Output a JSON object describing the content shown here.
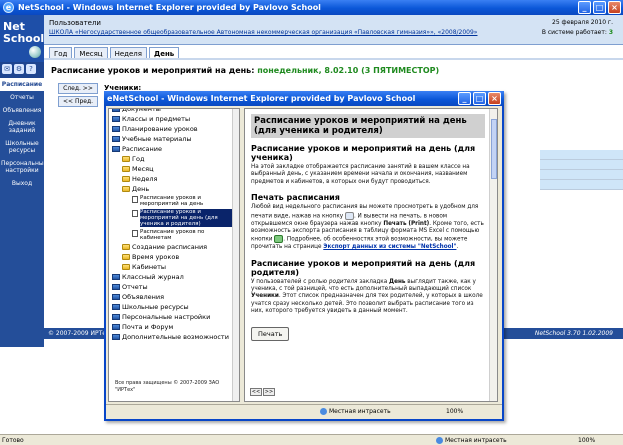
{
  "outer_window": {
    "title": "NetSchool - Windows Internet Explorer provided by Pavlovo School"
  },
  "logo": {
    "line1": "Net",
    "line2": "School"
  },
  "header": {
    "users_label": "Пользователи",
    "school_name": "ШКОЛА «Негосударственное общеобразовательное Автономная некоммерческая организация «Павловская гимназия»», «2008/2009»",
    "date": "25 февраля 2010 г.",
    "online_label": "В системе работает:",
    "online_count": "3"
  },
  "tabs": [
    {
      "label": "Год"
    },
    {
      "label": "Месяц"
    },
    {
      "label": "Неделя"
    },
    {
      "label": "День"
    }
  ],
  "sidebar": {
    "items": [
      {
        "label": "Расписание"
      },
      {
        "label": "Отчеты"
      },
      {
        "label": "Объявления"
      },
      {
        "label": "Дневник заданий"
      },
      {
        "label": "Школьные ресурсы"
      },
      {
        "label": "Персональные настройки"
      },
      {
        "label": "Выход"
      }
    ]
  },
  "page": {
    "heading_main": "Расписание уроков и мероприятий на день:",
    "heading_detail": "понедельник, 8.02.10 (3 ПЯТИМЕСТОР)",
    "next_btn": "След. >>",
    "prev_btn": "<< Пред.",
    "students_label": "Ученики:"
  },
  "footer": {
    "left": "© 2007-2009 ИРТех",
    "right": "NetSchool 3.70    1.02.2009"
  },
  "status_bar": {
    "done": "Готово",
    "zone": "Местная интрасеть",
    "zoom": "100%"
  },
  "popup": {
    "title": "NetSchool - Windows Internet Explorer provided by Pavlovo School",
    "tree": [
      {
        "label": "Документы",
        "icon": "book",
        "indent": 0
      },
      {
        "label": "Классы и предметы",
        "icon": "book",
        "indent": 0
      },
      {
        "label": "Планирование уроков",
        "icon": "book",
        "indent": 0
      },
      {
        "label": "Учебные материалы",
        "icon": "book",
        "indent": 0
      },
      {
        "label": "Расписание",
        "icon": "book",
        "indent": 0
      },
      {
        "label": "Год",
        "icon": "folder",
        "indent": 1
      },
      {
        "label": "Месяц",
        "icon": "folder",
        "indent": 1
      },
      {
        "label": "Неделя",
        "icon": "folder",
        "indent": 1
      },
      {
        "label": "День",
        "icon": "folder",
        "indent": 1
      },
      {
        "label": "Расписание уроков и мероприятий на день",
        "icon": "page",
        "indent": 2,
        "small": true
      },
      {
        "label": "Расписание уроков и мероприятий на день (для ученика и родителя)",
        "icon": "page",
        "indent": 2,
        "small": true,
        "selected": true
      },
      {
        "label": "Расписание уроков по кабинетам",
        "icon": "page",
        "indent": 2,
        "small": true
      },
      {
        "label": "Создание расписания",
        "icon": "folder",
        "indent": 1
      },
      {
        "label": "Время уроков",
        "icon": "folder",
        "indent": 1
      },
      {
        "label": "Кабинеты",
        "icon": "folder",
        "indent": 1
      },
      {
        "label": "Классный журнал",
        "icon": "book",
        "indent": 0
      },
      {
        "label": "Отчеты",
        "icon": "book",
        "indent": 0
      },
      {
        "label": "Объявления",
        "icon": "book",
        "indent": 0
      },
      {
        "label": "Школьные ресурсы",
        "icon": "book",
        "indent": 0
      },
      {
        "label": "Персональные настройки",
        "icon": "book",
        "indent": 0
      },
      {
        "label": "Почта и Форум",
        "icon": "book",
        "indent": 0
      },
      {
        "label": "Дополнительные возможности",
        "icon": "book",
        "indent": 0
      }
    ],
    "copyright": "Все права защищены © 2007-2009 ЗАО \"ИРТех\"",
    "content": {
      "main_title": "Расписание уроков и мероприятий на день (для ученика и родителя)",
      "s1_title": "Расписание уроков и мероприятий на день (для ученика)",
      "s1_text": "На этой закладке отображается расписание занятий в вашем классе на выбранный день, с указанием времени начала и окончания, названием предметов и кабинетов, в которых они будут проводиться.",
      "s2_title": "Печать расписания",
      "s2_text_a": "Любой вид недельного расписания вы можете просмотреть в удобном для печати виде, нажав на кнопку",
      "s2_text_b": ". И вывести на печать, в новом открывшемся окне браузера нажав кнопку",
      "s2_print_word": "Печать",
      "s2_print_en": "(Print)",
      "s2_text_c": ". Кроме того, есть возможность экспорта расписания в таблицу формата MS Excel с помощью кнопки",
      "s2_text_d": ". Подробнее, об особенностях этой возможности, вы можете прочитать на странице",
      "s2_link": "Экспорт данных из системы \"NetSchool\"",
      "s3_title": "Расписание уроков и мероприятий на день (для родителя)",
      "s3_text_a": "У пользователей с ролью",
      "s3_role": "родителя",
      "s3_text_b": "закладка",
      "s3_tab": "День",
      "s3_text_c": "выглядит также, как у ученика, с той разницей, что есть дополнительный выпадающий список",
      "s3_list": "Ученики",
      "s3_text_d": ". Этот список предназначен для тех родителей, у которых в школе учатся сразу несколько детей. Это позволит выбрать расписание того из них, которого требуется увидеть в данный момент.",
      "print_button": "Печать"
    },
    "status_zone": "Местная интрасеть",
    "status_zoom": "100%"
  }
}
